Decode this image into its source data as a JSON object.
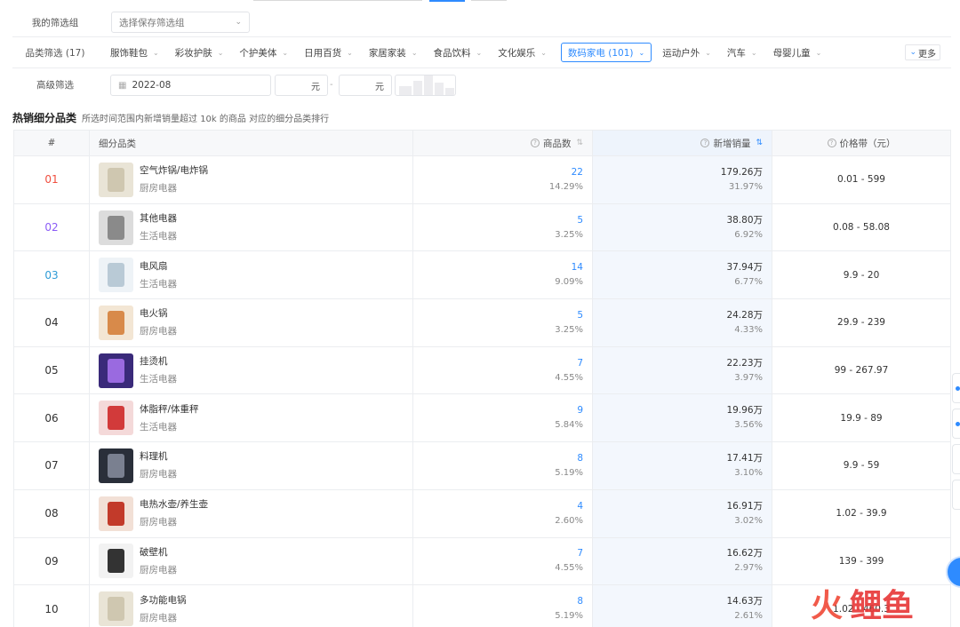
{
  "filters": {
    "saved_group": {
      "label": "我的筛选组",
      "placeholder": "选择保存筛选组"
    },
    "category": {
      "label": "品类筛选 (17)",
      "items": [
        {
          "label": "服饰鞋包",
          "active": false
        },
        {
          "label": "彩妆护肤",
          "active": false
        },
        {
          "label": "个护美体",
          "active": false
        },
        {
          "label": "日用百货",
          "active": false
        },
        {
          "label": "家居家装",
          "active": false
        },
        {
          "label": "食品饮料",
          "active": false
        },
        {
          "label": "文化娱乐",
          "active": false
        },
        {
          "label": "数码家电 (101)",
          "active": true
        },
        {
          "label": "运动户外",
          "active": false
        },
        {
          "label": "汽车",
          "active": false
        },
        {
          "label": "母婴儿童",
          "active": false
        }
      ],
      "more_label": "更多"
    },
    "advanced": {
      "label": "高级筛选",
      "date_value": "2022-08",
      "price_min_unit": "元",
      "price_max_unit": "元",
      "price_dash": "-"
    }
  },
  "section": {
    "title": "热销细分品类",
    "subtitle": "所选时间范围内新增销量超过 10k 的商品 对应的细分品类排行"
  },
  "table": {
    "headers": {
      "rank": "#",
      "category": "细分品类",
      "count": "商品数",
      "sales": "新增销量",
      "price": "价格带（元）"
    },
    "rows": [
      {
        "rank": "01",
        "name": "空气炸锅/电炸锅",
        "parent": "厨房电器",
        "count": "22",
        "count_pct": "14.29%",
        "sales": "179.26万",
        "sales_pct": "31.97%",
        "price": "0.01 - 599",
        "thumb": "air-fryer"
      },
      {
        "rank": "02",
        "name": "其他电器",
        "parent": "生活电器",
        "count": "5",
        "count_pct": "3.25%",
        "sales": "38.80万",
        "sales_pct": "6.92%",
        "price": "0.08 - 58.08",
        "thumb": "appliance"
      },
      {
        "rank": "03",
        "name": "电风扇",
        "parent": "生活电器",
        "count": "14",
        "count_pct": "9.09%",
        "sales": "37.94万",
        "sales_pct": "6.77%",
        "price": "9.9 - 20",
        "thumb": "fan"
      },
      {
        "rank": "04",
        "name": "电火锅",
        "parent": "厨房电器",
        "count": "5",
        "count_pct": "3.25%",
        "sales": "24.28万",
        "sales_pct": "4.33%",
        "price": "29.9 - 239",
        "thumb": "hotpot"
      },
      {
        "rank": "05",
        "name": "挂烫机",
        "parent": "生活电器",
        "count": "7",
        "count_pct": "4.55%",
        "sales": "22.23万",
        "sales_pct": "3.97%",
        "price": "99 - 267.97",
        "thumb": "steamer"
      },
      {
        "rank": "06",
        "name": "体脂秤/体重秤",
        "parent": "生活电器",
        "count": "9",
        "count_pct": "5.84%",
        "sales": "19.96万",
        "sales_pct": "3.56%",
        "price": "19.9 - 89",
        "thumb": "scale"
      },
      {
        "rank": "07",
        "name": "料理机",
        "parent": "厨房电器",
        "count": "8",
        "count_pct": "5.19%",
        "sales": "17.41万",
        "sales_pct": "3.10%",
        "price": "9.9 - 59",
        "thumb": "blender"
      },
      {
        "rank": "08",
        "name": "电热水壶/养生壶",
        "parent": "厨房电器",
        "count": "4",
        "count_pct": "2.60%",
        "sales": "16.91万",
        "sales_pct": "3.02%",
        "price": "1.02 - 39.9",
        "thumb": "kettle"
      },
      {
        "rank": "09",
        "name": "破壁机",
        "parent": "厨房电器",
        "count": "7",
        "count_pct": "4.55%",
        "sales": "16.62万",
        "sales_pct": "2.97%",
        "price": "139 - 399",
        "thumb": "juicer"
      },
      {
        "rank": "10",
        "name": "多功能电锅",
        "parent": "厨房电器",
        "count": "8",
        "count_pct": "5.19%",
        "sales": "14.63万",
        "sales_pct": "2.61%",
        "price": "1.02 - 460.3",
        "thumb": "cooker"
      }
    ]
  },
  "watermark": {
    "text": "火鲤鱼"
  },
  "colors": {
    "accent": "#2e8bff",
    "rank1": "#f04e3e",
    "rank2": "#8b5cf6",
    "rank3": "#2e9bd6"
  }
}
